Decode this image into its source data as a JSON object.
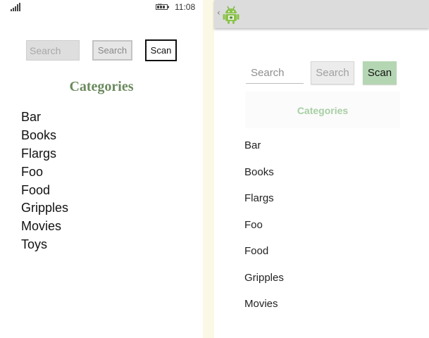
{
  "windows_phone": {
    "status_bar": {
      "time": "11:08",
      "signal_icon": "signal-bars-icon",
      "battery_icon": "battery-icon"
    },
    "search_placeholder": "Search",
    "search_button": "Search",
    "scan_button": "Scan",
    "title": "Categories",
    "categories": [
      "Bar",
      "Books",
      "Flargs",
      "Foo",
      "Food",
      "Gripples",
      "Movies",
      "Toys"
    ]
  },
  "android": {
    "action_bar": {
      "up_icon": "chevron-left-icon",
      "app_icon": "android-robot-icon"
    },
    "search_placeholder": "Search",
    "search_button": "Search",
    "scan_button": "Scan",
    "title": "Categories",
    "categories": [
      "Bar",
      "Books",
      "Flargs",
      "Foo",
      "Food",
      "Gripples",
      "Movies"
    ]
  },
  "colors": {
    "wp_title": "#6b8a5e",
    "android_title": "#a7cfa4",
    "android_scan_bg": "#b5d6b3",
    "android_actionbar": "#dcdcdc",
    "divider": "#fbf8e6"
  }
}
